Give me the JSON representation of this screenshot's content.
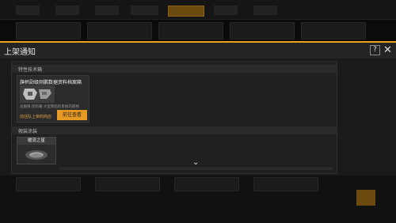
{
  "background": {
    "active_tab_color": "#6b4a10"
  },
  "modal": {
    "title": "上架通知",
    "help_icon": "?",
    "close_icon": "✕",
    "accent_color": "#f0a21e"
  },
  "tech_section": {
    "label": "特性技术箱",
    "card": {
      "title": "旗帜勋级刚鹏数据资料档案箱",
      "description": "总服限·资料箱·大型和暗的系统内容物",
      "hint": "前往队上架的商店",
      "button_label": "前往查看"
    }
  },
  "skin_section": {
    "label": "假装涂装",
    "card": {
      "name": "暖流之星"
    }
  },
  "scroll_indicator": "⌄"
}
